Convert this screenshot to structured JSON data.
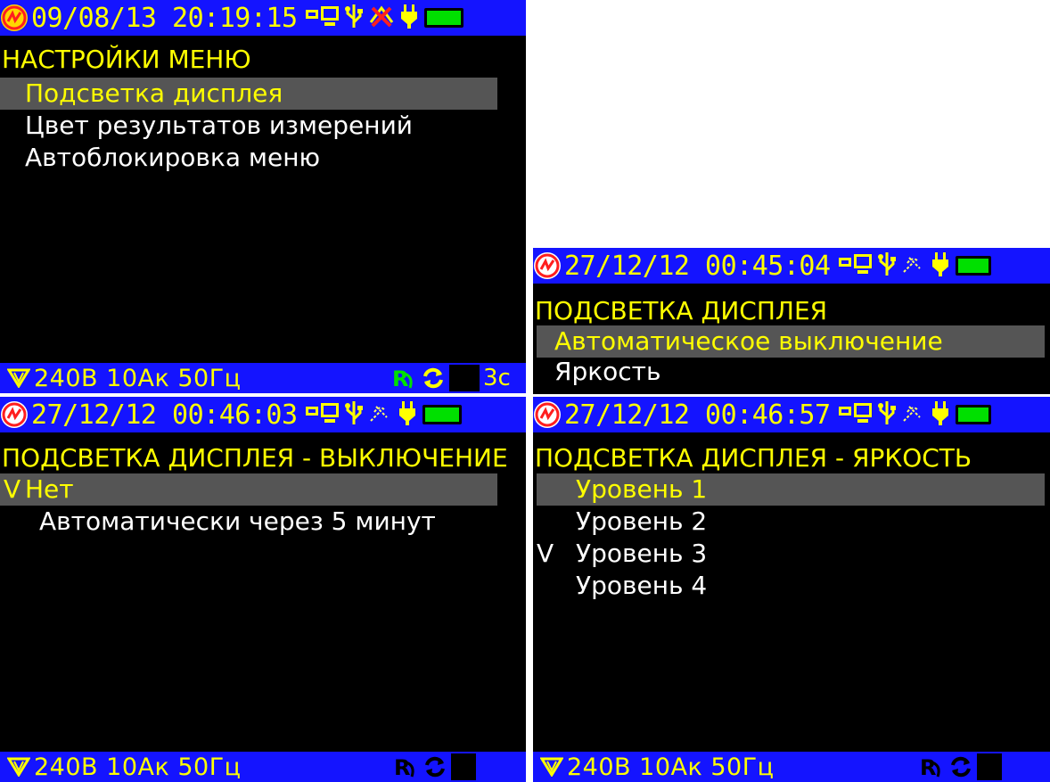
{
  "colors": {
    "statusbar": "#1414ff",
    "text_yellow": "#ffff00",
    "text_white": "#ffffff",
    "selected_bg": "#555555",
    "battery": "#00e000",
    "logo_red": "#ff1e1e",
    "logo_yellow": "#ffd600"
  },
  "screens": [
    {
      "datetime": "09/08/13 20:19:15",
      "title": "НАСТРОЙКИ МЕНЮ",
      "items": [
        "Подсветка дисплея",
        "Цвет результатов измерений",
        "Автоблокировка меню"
      ],
      "bottom": {
        "measure": "240В 10Ак 50Гц",
        "timer": "3с"
      }
    },
    {
      "datetime": "27/12/12 00:45:04",
      "title": "ПОДСВЕТКА ДИСПЛЕЯ",
      "items": [
        "Автоматическое выключение",
        "Яркость"
      ]
    },
    {
      "datetime": "27/12/12 00:46:03",
      "title": "ПОДСВЕТКА ДИСПЛЕЯ - ВЫКЛЮЧЕНИЕ",
      "check": "V",
      "items": [
        "Нет",
        "Автоматически через 5 минут"
      ],
      "bottom": {
        "measure": "240В 10Ак 50Гц"
      }
    },
    {
      "datetime": "27/12/12 00:46:57",
      "title": "ПОДСВЕТКА ДИСПЛЕЯ - ЯРКОСТЬ",
      "check": "V",
      "items": [
        "Уровень 1",
        "Уровень 2",
        "Уровень 3",
        "Уровень 4"
      ],
      "bottom": {
        "measure": "240В 10Ак 50Гц"
      }
    }
  ],
  "icons": [
    "logo-icon",
    "pc-connection-icon",
    "usb-icon",
    "gps-icon",
    "power-plug-icon",
    "battery-icon",
    "phase-triangle-icon",
    "recording-icon",
    "sync-icon"
  ]
}
